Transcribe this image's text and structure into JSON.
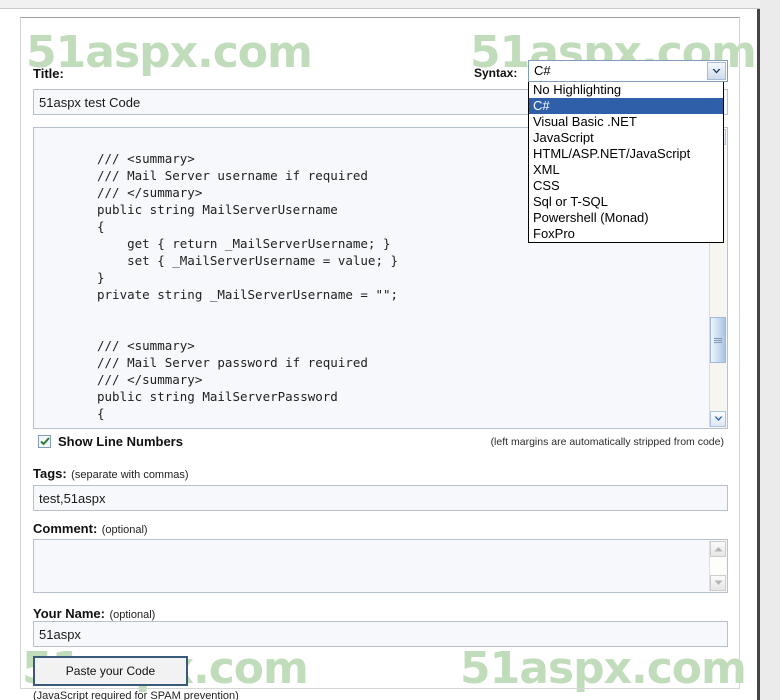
{
  "form": {
    "title_label": "Title:",
    "title_value": "51aspx test Code",
    "syntax_label": "Syntax:",
    "syntax_selected": "C#",
    "syntax_options": [
      "No Highlighting",
      "C#",
      "Visual Basic .NET",
      "JavaScript",
      "HTML/ASP.NET/JavaScript",
      "XML",
      "CSS",
      "Sql or T-SQL",
      "Powershell (Monad)",
      "FoxPro"
    ],
    "code_value": "/// <summary>\n/// Mail Server username if required\n/// </summary>\npublic string MailServerUsername\n{\n    get { return _MailServerUsername; }\n    set { _MailServerUsername = value; }\n}\nprivate string _MailServerUsername = \"\";\n\n\n/// <summary>\n/// Mail Server password if required\n/// </summary>\npublic string MailServerPassword\n{",
    "show_line_numbers_label": "Show Line Numbers",
    "show_line_numbers_checked": true,
    "margins_hint": "(left margins are automatically stripped from code)",
    "tags_label": "Tags:",
    "tags_hint": "(separate with commas)",
    "tags_value": "test,51aspx",
    "comment_label": "Comment:",
    "comment_hint": "(optional)",
    "comment_value": "",
    "name_label": "Your Name:",
    "name_hint": "(optional)",
    "name_value": "51aspx",
    "submit_label": "Paste your Code",
    "javascript_note": "(JavaScript required for SPAM prevention)"
  },
  "watermark": {
    "text": "51aspx.com"
  },
  "colors": {
    "watermark_green": "#a8cfa2",
    "select_highlight": "#2f5fa8",
    "input_bg": "#f6f8fb",
    "input_border": "#b7c0cb",
    "button_border": "#3a5a7a"
  }
}
